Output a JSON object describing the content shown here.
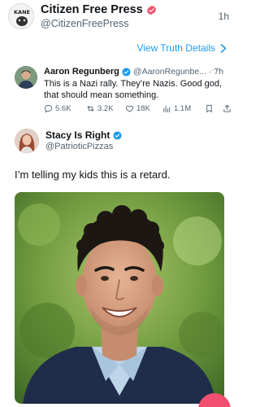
{
  "post": {
    "account_name": "Citizen Free Press",
    "handle": "@CitizenFreePress",
    "time": "1h",
    "avatar_text": "KANE"
  },
  "link": {
    "view_truth_label": "View Truth Details"
  },
  "truth": {
    "author_name": "Aaron Regunberg",
    "author_handle": "@AaronRegunbe...",
    "time": "7h",
    "text": "This is a Nazi rally. They’re Nazis. Good god, that should mean something.",
    "actions": {
      "replies": "5.6K",
      "retruths": "3.2K",
      "likes": "18K",
      "views": "1.1M"
    }
  },
  "reply": {
    "author_name": "Stacy Is Right",
    "author_handle": "@PatrioticPizzas",
    "text": "I’m telling my kids this is a retard."
  },
  "colors": {
    "accent": "#1d9bf0",
    "verified_red": "#f0506e",
    "muted": "#536471"
  }
}
